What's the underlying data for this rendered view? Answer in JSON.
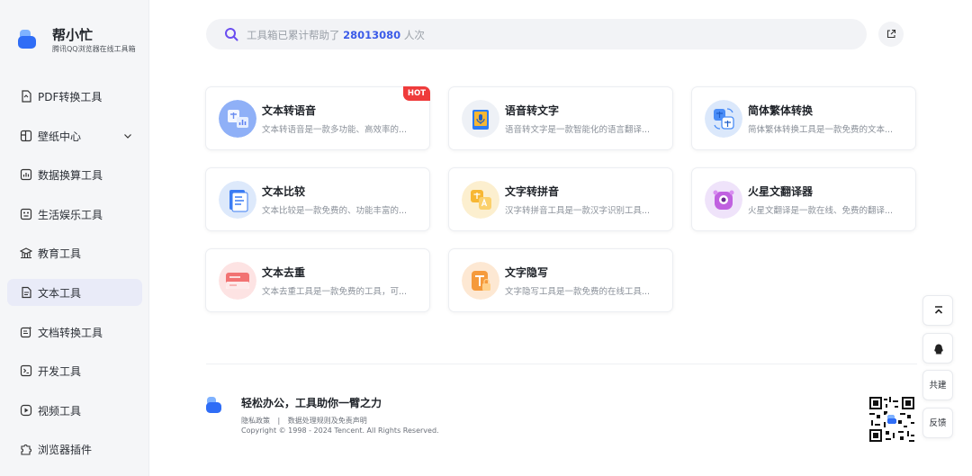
{
  "brand": {
    "title": "帮小忙",
    "subtitle": "腾讯QQ浏览器在线工具箱"
  },
  "nav": [
    {
      "label": "PDF转换工具",
      "icon": "pdf-icon"
    },
    {
      "label": "壁纸中心",
      "icon": "wallpaper-icon",
      "has_chevron": true
    },
    {
      "label": "数据换算工具",
      "icon": "calculator-icon"
    },
    {
      "label": "生活娱乐工具",
      "icon": "life-icon"
    },
    {
      "label": "教育工具",
      "icon": "education-icon"
    },
    {
      "label": "文本工具",
      "icon": "text-icon",
      "active": true
    },
    {
      "label": "文档转换工具",
      "icon": "document-icon"
    },
    {
      "label": "开发工具",
      "icon": "code-icon"
    },
    {
      "label": "视频工具",
      "icon": "video-icon"
    },
    {
      "label": "浏览器插件",
      "icon": "plugin-icon"
    }
  ],
  "search": {
    "prefix": "工具箱已累计帮助了",
    "count": "28013080",
    "suffix": "人次"
  },
  "cards": [
    {
      "title": "文本转语音",
      "desc": "文本转语音是一款多功能、高效率的...",
      "badge": "HOT",
      "icon": "text-to-speech-icon",
      "color": "#8fb0f7"
    },
    {
      "title": "语音转文字",
      "desc": "语音转文字是一款智能化的语言翻译...",
      "icon": "speech-to-text-icon",
      "color": "#e8edf5"
    },
    {
      "title": "简体繁体转换",
      "desc": "简体繁体转换工具是一款免费的文本...",
      "icon": "simplified-traditional-icon",
      "color": "#dbe8fb"
    },
    {
      "title": "文本比较",
      "desc": "文本比较是一款免费的、功能丰富的...",
      "icon": "text-compare-icon",
      "color": "#dde9fb"
    },
    {
      "title": "文字转拼音",
      "desc": "汉字转拼音工具是一款汉字识别工具...",
      "icon": "pinyin-icon",
      "color": "#fcefcf"
    },
    {
      "title": "火星文翻译器",
      "desc": "火星文翻译是一款在线、免费的翻译...",
      "icon": "martian-translator-icon",
      "color": "#efe3fa"
    },
    {
      "title": "文本去重",
      "desc": "文本去重工具是一款免费的工具，可...",
      "icon": "dedupe-icon",
      "color": "#fde3e3"
    },
    {
      "title": "文字隐写",
      "desc": "文字隐写工具是一款免费的在线工具...",
      "icon": "steganography-icon",
      "color": "#fde8d3"
    }
  ],
  "footer": {
    "slogan": "轻松办公，工具助你一臂之力",
    "privacy": "隐私政策",
    "separator": "|",
    "data_rules": "数据处理规则及免责声明",
    "copyright": "Copyright © 1998 - 2024 Tencent. All Rights Reserved."
  },
  "floats": {
    "top_icon": "back-to-top-icon",
    "qq_icon": "qq-icon",
    "build": "共建",
    "feedback": "反馈"
  },
  "colors": {
    "accent": "#3b5be8",
    "hot": "#ef3b3b",
    "active_bg": "#e9ebf8"
  }
}
